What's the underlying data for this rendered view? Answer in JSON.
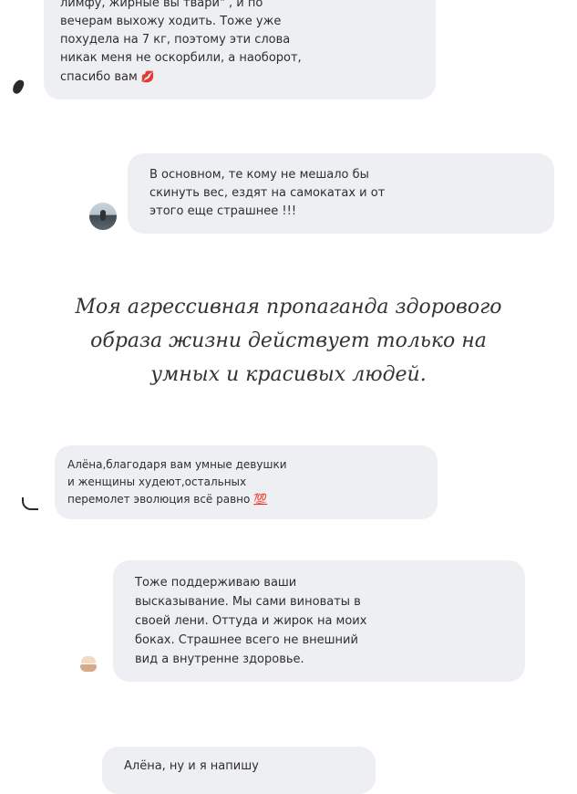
{
  "messages": [
    {
      "lines": [
        "лимфу, жирные вы твари\" , и по",
        "вечерам выхожу ходить. Тоже уже",
        "похудела на 7 кг, поэтому эти слова",
        "никак меня не оскорбили, а наоборот,",
        "спасибо вам"
      ],
      "emoji": "💋"
    },
    {
      "lines": [
        "В основном, те кому не мешало бы",
        "скинуть вес, ездят на самокатах и от",
        "этого еще страшнее !!!"
      ]
    },
    {
      "lines": [
        "Алёна,благодаря вам умные девушки",
        "и женщины худеют,остальных",
        "перемолет эволюция всё равно"
      ],
      "emoji": "💯"
    },
    {
      "lines": [
        "Тоже поддерживаю ваши",
        "высказывание. Мы сами виноваты в",
        "своей лени. Оттуда и жирок на моих",
        "боках. Страшнее всего не внешний",
        "вид а внутренне здоровье."
      ]
    },
    {
      "lines": [
        "Алёна, ну и я напишу"
      ]
    }
  ],
  "caption": {
    "lines": [
      "Моя агрессивная пропаганда здорового",
      "образа жизни действует только на",
      "умных и красивых людей."
    ]
  },
  "icons": {
    "avatar_1": "bird-avatar",
    "avatar_2": "photo-avatar",
    "avatar_3": "sketch-avatar",
    "avatar_4": "cake-avatar"
  },
  "colors": {
    "bubble": "#eeeff2",
    "text": "#2e2e2e",
    "caption": "#333333"
  }
}
